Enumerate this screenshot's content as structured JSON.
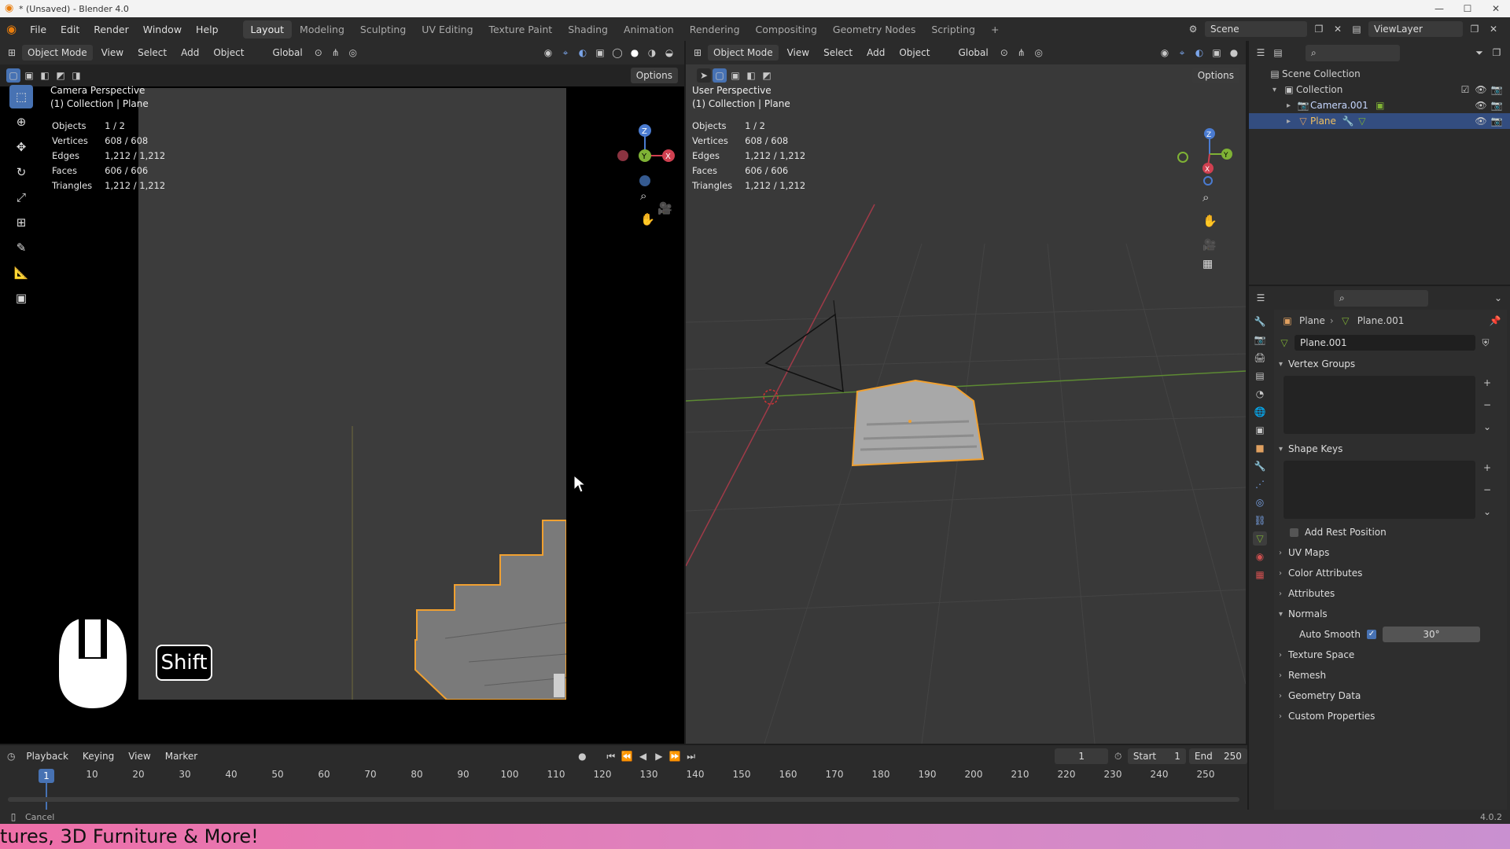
{
  "window": {
    "title": "* (Unsaved) - Blender 4.0"
  },
  "menu": [
    "File",
    "Edit",
    "Render",
    "Window",
    "Help"
  ],
  "workspaces": [
    "Layout",
    "Modeling",
    "Sculpting",
    "UV Editing",
    "Texture Paint",
    "Shading",
    "Animation",
    "Rendering",
    "Compositing",
    "Geometry Nodes",
    "Scripting"
  ],
  "topright": {
    "scene": "Scene",
    "view_layer": "ViewLayer"
  },
  "viewport_left": {
    "mode": "Object Mode",
    "menus": [
      "View",
      "Select",
      "Add",
      "Object"
    ],
    "orientation": "Global",
    "options": "Options",
    "perspective": "Camera Perspective",
    "collection": "(1) Collection | Plane",
    "stats": [
      {
        "label": "Objects",
        "value": "1 / 2"
      },
      {
        "label": "Vertices",
        "value": "608 / 608"
      },
      {
        "label": "Edges",
        "value": "1,212 / 1,212"
      },
      {
        "label": "Faces",
        "value": "606 / 606"
      },
      {
        "label": "Triangles",
        "value": "1,212 / 1,212"
      }
    ],
    "key_overlay": "Shift"
  },
  "viewport_right": {
    "mode": "Object Mode",
    "menus": [
      "View",
      "Select",
      "Add",
      "Object"
    ],
    "orientation": "Global",
    "options": "Options",
    "perspective": "User Perspective",
    "collection": "(1) Collection | Plane",
    "stats": [
      {
        "label": "Objects",
        "value": "1 / 2"
      },
      {
        "label": "Vertices",
        "value": "608 / 608"
      },
      {
        "label": "Edges",
        "value": "1,212 / 1,212"
      },
      {
        "label": "Faces",
        "value": "606 / 606"
      },
      {
        "label": "Triangles",
        "value": "1,212 / 1,212"
      }
    ]
  },
  "outliner": {
    "scene_collection": "Scene Collection",
    "collection": "Collection",
    "items": [
      "Camera.001",
      "Plane"
    ]
  },
  "properties": {
    "breadcrumb_object": "Plane",
    "breadcrumb_data": "Plane.001",
    "mesh_name": "Plane.001",
    "sections": {
      "vertex_groups": "Vertex Groups",
      "shape_keys": "Shape Keys",
      "add_rest_position": "Add Rest Position",
      "uv_maps": "UV Maps",
      "color_attributes": "Color Attributes",
      "attributes": "Attributes",
      "normals": "Normals",
      "auto_smooth": "Auto Smooth",
      "auto_smooth_angle": "30°",
      "texture_space": "Texture Space",
      "remesh": "Remesh",
      "geometry_data": "Geometry Data",
      "custom_properties": "Custom Properties"
    }
  },
  "timeline": {
    "menus": [
      "Playback",
      "Keying",
      "View",
      "Marker"
    ],
    "current_frame": "1",
    "start_label": "Start",
    "start": "1",
    "end_label": "End",
    "end": "250",
    "ticks": [
      "10",
      "20",
      "30",
      "40",
      "50",
      "60",
      "70",
      "80",
      "90",
      "100",
      "110",
      "120",
      "130",
      "140",
      "150",
      "160",
      "170",
      "180",
      "190",
      "200",
      "210",
      "220",
      "230",
      "240",
      "250"
    ],
    "marker": "1"
  },
  "statusbar": {
    "left": "Cancel",
    "version": "4.0.2"
  },
  "banner": {
    "text": "tures, 3D Furniture & More!"
  }
}
